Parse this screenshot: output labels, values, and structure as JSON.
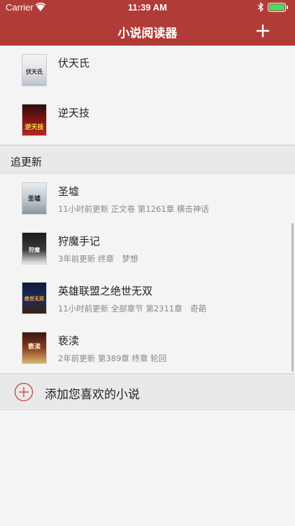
{
  "status_bar": {
    "carrier": "Carrier",
    "time": "11:39 AM",
    "battery_color": "#4cd964"
  },
  "nav": {
    "title": "小说阅读器",
    "background": "#b13c37"
  },
  "library_books": [
    {
      "title": "伏天氏",
      "cover_text": "伏天氏"
    },
    {
      "title": "逆天技",
      "cover_text": "逆天技"
    }
  ],
  "section": {
    "title": "追更新"
  },
  "following_books": [
    {
      "title": "圣墟",
      "meta": "11小时前更新 正文卷 第1261章 横击神话",
      "cover_text": "圣墟"
    },
    {
      "title": "狩魔手记",
      "meta": "3年前更新 终章　梦想",
      "cover_text": "狩魔"
    },
    {
      "title": "英雄联盟之绝世无双",
      "meta": "11小时前更新 全部章节 第2311章　奇葩",
      "cover_text": "绝世无双"
    },
    {
      "title": "亵渎",
      "meta": "2年前更新 第389章 终章 轮回",
      "cover_text": "亵渎"
    }
  ],
  "add_row": {
    "label": "添加您喜欢的小说"
  }
}
